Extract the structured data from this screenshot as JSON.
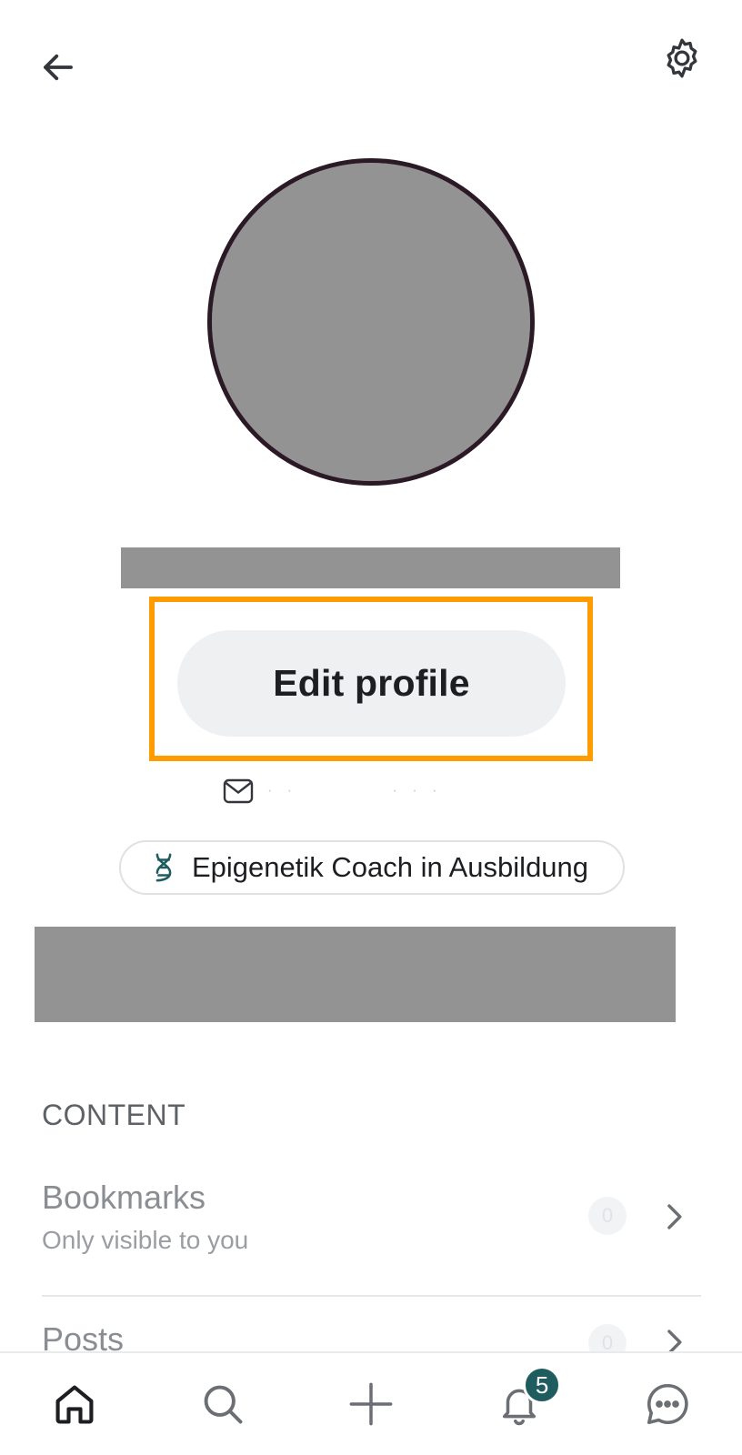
{
  "header": {
    "back_icon": "arrow-left-icon",
    "settings_icon": "gear-icon"
  },
  "profile": {
    "edit_button_label": "Edit profile",
    "badge_icon": "dna-icon",
    "badge_label": "Epigenetik Coach in Ausbildung",
    "email_icon": "envelope-icon"
  },
  "content_section": {
    "title": "CONTENT",
    "rows": [
      {
        "title": "Bookmarks",
        "subtitle": "Only visible to you",
        "count": "0"
      },
      {
        "title": "Posts",
        "count": "0"
      }
    ]
  },
  "bottom_nav": {
    "items": [
      {
        "icon": "home-icon",
        "active": true
      },
      {
        "icon": "search-icon"
      },
      {
        "icon": "plus-icon"
      },
      {
        "icon": "bell-icon",
        "badge": "5"
      },
      {
        "icon": "chat-icon"
      }
    ]
  },
  "colors": {
    "highlight": "#ff9c00",
    "badge_bg": "#1f5c60",
    "button_bg": "#eff0f2"
  }
}
